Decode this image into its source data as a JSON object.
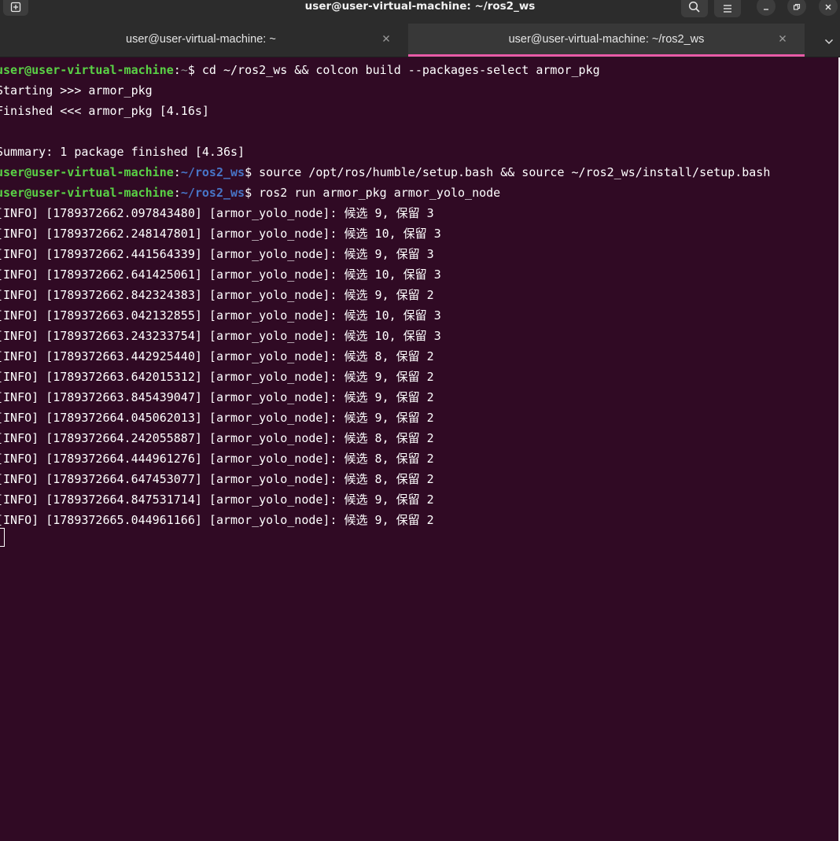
{
  "window": {
    "title": "user@user-virtual-machine: ~/ros2_ws"
  },
  "icons": {
    "new_tab": "new-tab-icon",
    "search": "search-icon",
    "menu": "hamburger-menu-icon",
    "minimize": "minimize-icon",
    "maximize": "restore-icon",
    "close": "close-icon",
    "tab_close": "close-icon",
    "tab_overflow": "chevron-down-icon"
  },
  "colors": {
    "terminal_bg": "#300a24",
    "prompt_user": "#5ad246",
    "prompt_path": "#4875c7",
    "active_tab_accent": "#e95aa8"
  },
  "tabs": [
    {
      "label": "user@user-virtual-machine: ~",
      "active": false
    },
    {
      "label": "user@user-virtual-machine: ~/ros2_ws",
      "active": true
    }
  ],
  "terminal": {
    "prompt_user": "user@user-virtual-machine",
    "prompt_colon": ":",
    "prompt_dollar": "$ ",
    "lines": [
      {
        "type": "prompt",
        "path": "~",
        "path_style": "gray",
        "command": "cd ~/ros2_ws && colcon build --packages-select armor_pkg"
      },
      {
        "type": "output",
        "text": "Starting >>> armor_pkg"
      },
      {
        "type": "output",
        "text": "Finished <<< armor_pkg [4.16s]"
      },
      {
        "type": "output",
        "text": ""
      },
      {
        "type": "output",
        "text": "Summary: 1 package finished [4.36s]"
      },
      {
        "type": "prompt",
        "path": "~/ros2_ws",
        "path_style": "blue",
        "command": "source /opt/ros/humble/setup.bash && source ~/ros2_ws/install/setup.bash"
      },
      {
        "type": "prompt",
        "path": "~/ros2_ws",
        "path_style": "blue",
        "command": "ros2 run armor_pkg armor_yolo_node"
      },
      {
        "type": "output",
        "text": "[INFO] [1789372662.097843480] [armor_yolo_node]: 候选 9, 保留 3"
      },
      {
        "type": "output",
        "text": "[INFO] [1789372662.248147801] [armor_yolo_node]: 候选 10, 保留 3"
      },
      {
        "type": "output",
        "text": "[INFO] [1789372662.441564339] [armor_yolo_node]: 候选 9, 保留 3"
      },
      {
        "type": "output",
        "text": "[INFO] [1789372662.641425061] [armor_yolo_node]: 候选 10, 保留 3"
      },
      {
        "type": "output",
        "text": "[INFO] [1789372662.842324383] [armor_yolo_node]: 候选 9, 保留 2"
      },
      {
        "type": "output",
        "text": "[INFO] [1789372663.042132855] [armor_yolo_node]: 候选 10, 保留 3"
      },
      {
        "type": "output",
        "text": "[INFO] [1789372663.243233754] [armor_yolo_node]: 候选 10, 保留 3"
      },
      {
        "type": "output",
        "text": "[INFO] [1789372663.442925440] [armor_yolo_node]: 候选 8, 保留 2"
      },
      {
        "type": "output",
        "text": "[INFO] [1789372663.642015312] [armor_yolo_node]: 候选 9, 保留 2"
      },
      {
        "type": "output",
        "text": "[INFO] [1789372663.845439047] [armor_yolo_node]: 候选 9, 保留 2"
      },
      {
        "type": "output",
        "text": "[INFO] [1789372664.045062013] [armor_yolo_node]: 候选 9, 保留 2"
      },
      {
        "type": "output",
        "text": "[INFO] [1789372664.242055887] [armor_yolo_node]: 候选 8, 保留 2"
      },
      {
        "type": "output",
        "text": "[INFO] [1789372664.444961276] [armor_yolo_node]: 候选 8, 保留 2"
      },
      {
        "type": "output",
        "text": "[INFO] [1789372664.647453077] [armor_yolo_node]: 候选 8, 保留 2"
      },
      {
        "type": "output",
        "text": "[INFO] [1789372664.847531714] [armor_yolo_node]: 候选 9, 保留 2"
      },
      {
        "type": "output",
        "text": "[INFO] [1789372665.044961166] [armor_yolo_node]: 候选 9, 保留 2"
      }
    ]
  }
}
